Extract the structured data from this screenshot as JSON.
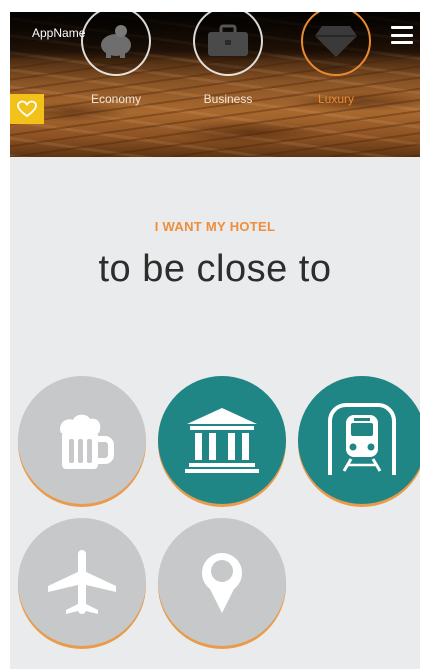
{
  "header": {
    "app_name": "AppName",
    "categories": [
      {
        "label": "Economy",
        "icon": "piggy-bank-icon",
        "active": false
      },
      {
        "label": "Business",
        "icon": "briefcase-icon",
        "active": false
      },
      {
        "label": "Luxury",
        "icon": "diamond-icon",
        "active": true
      }
    ],
    "menu_icon": "hamburger-menu-icon",
    "favorite_icon": "heart-icon"
  },
  "main": {
    "eyebrow": "I WANT MY HOTEL",
    "headline": "to be close to",
    "options": [
      {
        "icon": "beer-mug-icon",
        "selected": false
      },
      {
        "icon": "museum-icon",
        "selected": true
      },
      {
        "icon": "train-icon",
        "selected": true
      },
      {
        "icon": "airplane-icon",
        "selected": false
      },
      {
        "icon": "location-pin-icon",
        "selected": false
      }
    ]
  },
  "colors": {
    "accent_orange": "#ef8e3c",
    "selected_teal": "#1f8585",
    "unselected_grey": "#c6c8ca",
    "badge_yellow": "#f2c21b",
    "background": "#e9ebec"
  }
}
